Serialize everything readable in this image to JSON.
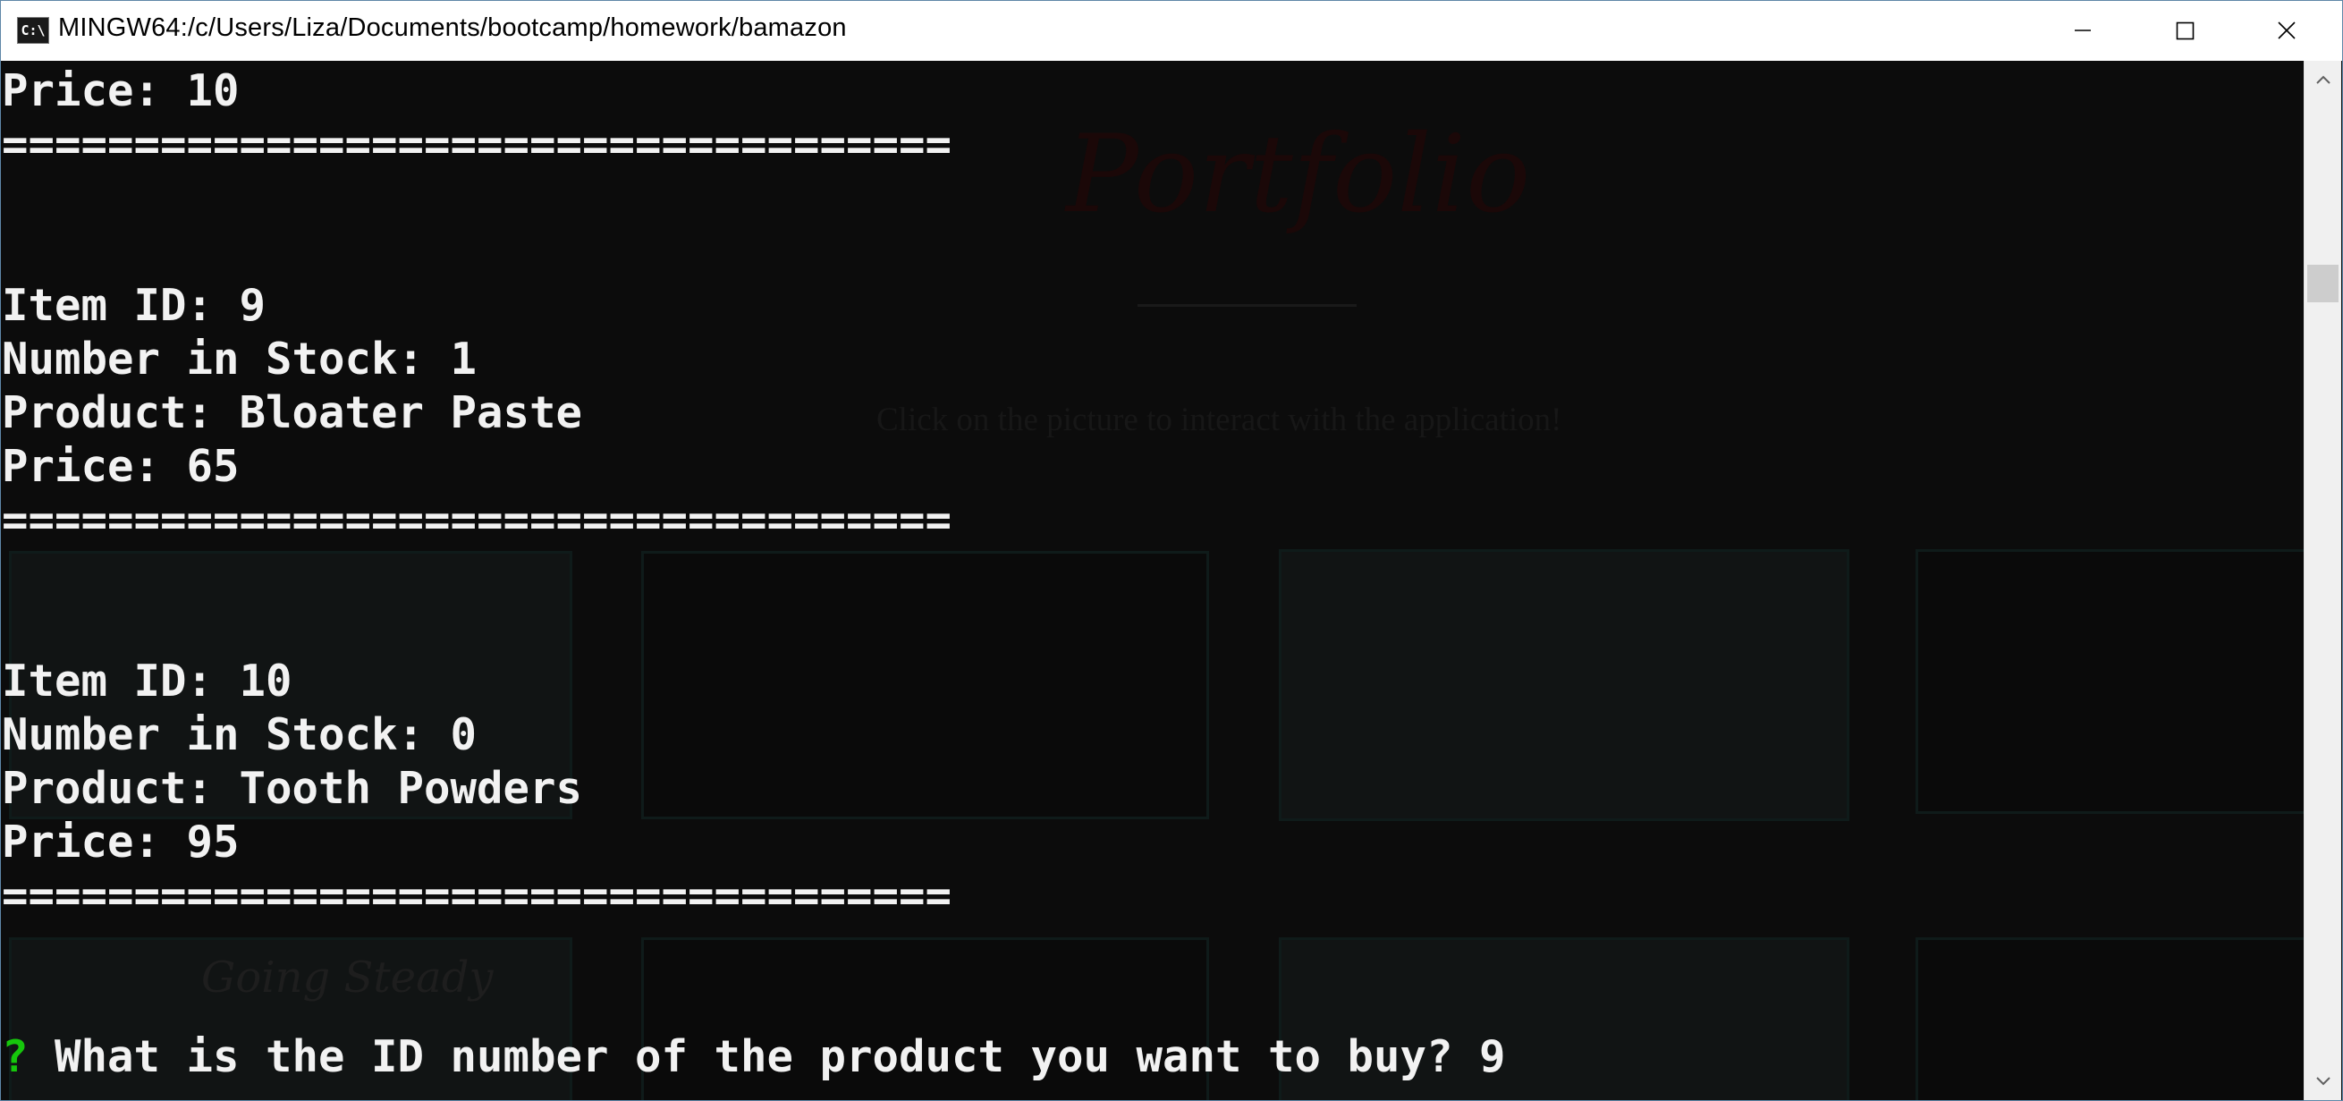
{
  "window": {
    "title": "MINGW64:/c/Users/Liza/Documents/bootcamp/homework/bamazon",
    "icon_label": "C:\\",
    "icon": "console-icon",
    "controls": {
      "minimize": "minimize-icon",
      "maximize": "maximize-icon",
      "close": "close-icon"
    }
  },
  "background": {
    "title": "Portfolio",
    "caption": "Click on the picture to interact with the application!",
    "card_text": "Going Steady"
  },
  "terminal": {
    "lines": [
      "Price: 10",
      "====================================",
      "",
      "",
      "Item ID: 9",
      "Number in Stock: 1",
      "Product: Bloater Paste",
      "Price: 65",
      "====================================",
      "",
      "",
      "Item ID: 10",
      "Number in Stock: 0",
      "Product: Tooth Powders",
      "Price: 95",
      "===================================="
    ],
    "prompt": {
      "mark": "?",
      "question": " What is the ID number of the product you want to buy? 9"
    },
    "colors": {
      "background": "#0c0c0c",
      "text": "#f2f2f2",
      "prompt_mark": "#16c60c"
    }
  },
  "scrollbar": {
    "up": "chevron-up-icon",
    "down": "chevron-down-icon"
  }
}
